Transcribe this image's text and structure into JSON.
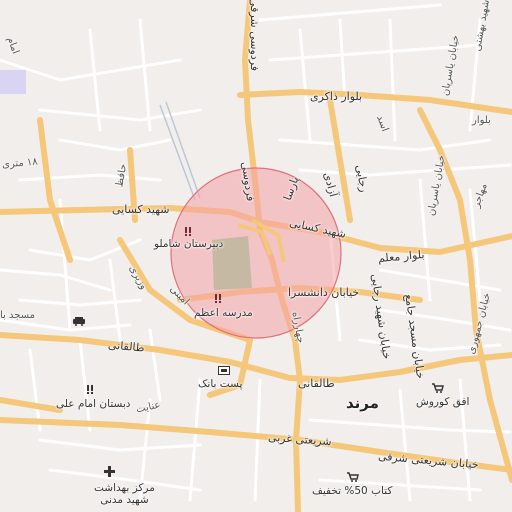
{
  "map": {
    "colors": {
      "background": "#f1eeeb",
      "major_road": "#f5c77a",
      "minor_road": "#ffffff",
      "highlight_fill": "#f4a3a8",
      "highlight_stroke": "#e0707a",
      "park": "#c6b9a3",
      "rail": "#b9c6d8"
    },
    "city_label": "مرند",
    "streets": {
      "kasaei_west": "شهید کسایی",
      "kasaei_east": "شهید کسایی",
      "boulevard_moallem": "بلوار معلم",
      "boulevard_zakeri": "بلوار ذاکری",
      "daneshsara": "خیابان دانشسرا",
      "taleghani_west": "طالقانی",
      "taleghani_east": "طالقانی",
      "shariati_gharbi": "شریعتی غربی",
      "shariati_sharghi": "خیابان شریعتی شرقی",
      "ferdowsi_north": "فردوسی شرقی",
      "ferdowsi_south": "فردوسی",
      "parsa": "پارسا",
      "rajaei": "رجایی",
      "azadi": "آزادی",
      "shahid_rajaei_st": "خیابان شهید رجایی",
      "masjed_jame": "خیابان مسجد جامع",
      "yasrian_1": "خیابان یاسریان",
      "yasrian_2": "خیابان یاسریان",
      "rah_ahan": "راه آهن",
      "shahid_beheshti": "شهید بهشتی",
      "boulevard_east": "بلوار",
      "emam": "امام",
      "amin": "امین",
      "jamhuri": "خیابان جمهوری",
      "meter_18": "۱۸ متری",
      "hafez": "حافظ",
      "mohajer": "مهاجر",
      "asad": "اسد",
      "fardin": "فردین",
      "enayat": "عنایت",
      "amini": "امینی",
      "vazir": "وزیری",
      "masjed_bagh": "مسجد با",
      "tabriz_road": "چهارراه",
      "asr": "عصر"
    },
    "pois": {
      "school_shamloo": "دبیرستان شاملو",
      "school_azam": "مدرسه اعظم",
      "post_bank": "پست بانک",
      "school_emam_ali": "دبستان امام علی",
      "ofogh_kourosh": "افق کوروش",
      "book_discount": "کتاب 50% تخفیف",
      "health_center": "مرکز بهداشت\nشهید مدنی"
    },
    "icons": {
      "school": "school-icon",
      "bank": "bank-icon",
      "shop": "shopping-cart-icon",
      "health": "medical-cross-icon",
      "car": "car-icon"
    }
  }
}
